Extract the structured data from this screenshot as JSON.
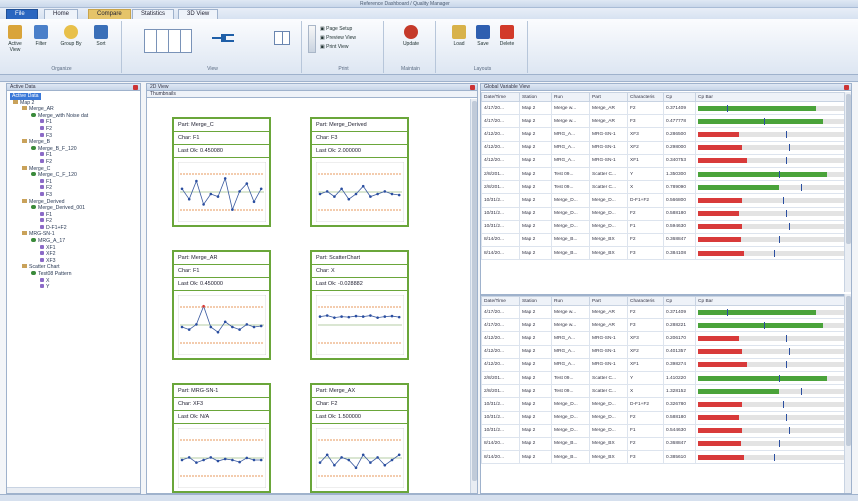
{
  "window": {
    "title": "Reference Dashboard / Quality Manager"
  },
  "tabs": {
    "file": "File",
    "home": "Home",
    "ctx1": "Compare",
    "ctx2": "Statistics",
    "view": "3D View"
  },
  "ribbon": {
    "organize": {
      "label": "Organize",
      "buttons": [
        "Active View",
        "Filter",
        "Group By",
        "Sort"
      ]
    },
    "view": {
      "label": "View"
    },
    "print": {
      "label": "Print",
      "items": [
        "Page Setup",
        "Preview View",
        "Print View"
      ]
    },
    "maintain": {
      "label": "Maintain",
      "button": "Update"
    },
    "layouts": {
      "label": "Layouts",
      "buttons": [
        "Load",
        "Save",
        "Delete"
      ]
    }
  },
  "tree": {
    "header": "Active Data",
    "selected": "Active Data",
    "nodes": [
      {
        "t": "Map 2",
        "d": 0,
        "k": "folder"
      },
      {
        "t": "Merge_AR",
        "d": 1,
        "k": "folder"
      },
      {
        "t": "Merge_with Noise dat",
        "d": 2,
        "k": "node"
      },
      {
        "t": "F1",
        "d": 3,
        "k": "leaf"
      },
      {
        "t": "F2",
        "d": 3,
        "k": "leaf"
      },
      {
        "t": "F3",
        "d": 3,
        "k": "leaf"
      },
      {
        "t": "Merge_B",
        "d": 1,
        "k": "folder"
      },
      {
        "t": "Merge_B_F_120",
        "d": 2,
        "k": "node"
      },
      {
        "t": "F1",
        "d": 3,
        "k": "leaf"
      },
      {
        "t": "F2",
        "d": 3,
        "k": "leaf"
      },
      {
        "t": "Merge_C",
        "d": 1,
        "k": "folder"
      },
      {
        "t": "Merge_C_F_120",
        "d": 2,
        "k": "node"
      },
      {
        "t": "F1",
        "d": 3,
        "k": "leaf"
      },
      {
        "t": "F2",
        "d": 3,
        "k": "leaf"
      },
      {
        "t": "F3",
        "d": 3,
        "k": "leaf"
      },
      {
        "t": "Merge_Derived",
        "d": 1,
        "k": "folder"
      },
      {
        "t": "Merge_Derived_001",
        "d": 2,
        "k": "node"
      },
      {
        "t": "F1",
        "d": 3,
        "k": "leaf"
      },
      {
        "t": "F2",
        "d": 3,
        "k": "leaf"
      },
      {
        "t": "D-F1+F2",
        "d": 3,
        "k": "leaf"
      },
      {
        "t": "MRG-SN-1",
        "d": 1,
        "k": "folder"
      },
      {
        "t": "MRG_A_17",
        "d": 2,
        "k": "node"
      },
      {
        "t": "XF1",
        "d": 3,
        "k": "leaf"
      },
      {
        "t": "XF2",
        "d": 3,
        "k": "leaf"
      },
      {
        "t": "XF3",
        "d": 3,
        "k": "leaf"
      },
      {
        "t": "Scatter Chart",
        "d": 1,
        "k": "folder"
      },
      {
        "t": "Test08 Pattern",
        "d": 2,
        "k": "node"
      },
      {
        "t": "X",
        "d": 3,
        "k": "leaf"
      },
      {
        "t": "Y",
        "d": 3,
        "k": "leaf"
      }
    ]
  },
  "center": {
    "header": "2D View",
    "subheader": "Thumbnails"
  },
  "cards": [
    {
      "part": "Part: Merge_C",
      "char": "Char: F1",
      "lastok": "Last Ok: 0.450080"
    },
    {
      "part": "Part: Merge_Derived",
      "char": "Char: F3",
      "lastok": "Last Ok: 2.000000"
    },
    {
      "part": "Part: Merge_AR",
      "char": "Char: F1",
      "lastok": "Last Ok: 0.450000"
    },
    {
      "part": "Part: ScatterChart",
      "char": "Char: X",
      "lastok": "Last Ok: -0.028882"
    },
    {
      "part": "Part: MRG-SN-1",
      "char": "Char: XF3",
      "lastok": "Last Ok: N/A"
    },
    {
      "part": "Part: Merge_AX",
      "char": "Char: F2",
      "lastok": "Last Ok: 1.500000"
    }
  ],
  "right": {
    "header": "Global Variable View"
  },
  "grid": {
    "columns": [
      "Date/Time",
      "Station",
      "Run",
      "Part",
      "Characteris",
      "Cp",
      "Cp Bar"
    ],
    "rows1": [
      {
        "c": [
          "4/17/20...",
          "Map 2",
          "Merge w...",
          "Merge_AR",
          "F2",
          "0.371409"
        ],
        "v": 0.8,
        "col": "#4aa33a",
        "m": 0.2
      },
      {
        "c": [
          "4/17/20...",
          "Map 2",
          "Merge w...",
          "Merge_AR",
          "F3",
          "0.477778"
        ],
        "v": 0.85,
        "col": "#4aa33a",
        "m": 0.45
      },
      {
        "c": [
          "4/12/20...",
          "Map 2",
          "MRG_A...",
          "MRG-SN-1",
          "XF3",
          "0.286500"
        ],
        "v": 0.28,
        "col": "#d83a3a",
        "m": 0.6
      },
      {
        "c": [
          "4/12/20...",
          "Map 2",
          "MRG_A...",
          "MRG-SN-1",
          "XF2",
          "0.298000"
        ],
        "v": 0.3,
        "col": "#d83a3a",
        "m": 0.62
      },
      {
        "c": [
          "4/12/20...",
          "Map 2",
          "MRG_A...",
          "MRG-SN-1",
          "XF1",
          "0.340753"
        ],
        "v": 0.33,
        "col": "#d83a3a",
        "m": 0.6
      },
      {
        "c": [
          "2/8/201...",
          "Map 2",
          "Test 09...",
          "Scatter C...",
          "Y",
          "1.350300"
        ],
        "v": 0.88,
        "col": "#4aa33a",
        "m": 0.55
      },
      {
        "c": [
          "2/8/201...",
          "Map 2",
          "Test 09...",
          "Scatter C...",
          "X",
          "0.789090"
        ],
        "v": 0.55,
        "col": "#4aa33a",
        "m": 0.7
      },
      {
        "c": [
          "10/31/2...",
          "Map 2",
          "Merge_D...",
          "Merge_D...",
          "D-F1+F2",
          "0.566800"
        ],
        "v": 0.3,
        "col": "#d83a3a",
        "m": 0.58
      },
      {
        "c": [
          "10/31/2...",
          "Map 2",
          "Merge_D...",
          "Merge_D...",
          "F2",
          "0.588180"
        ],
        "v": 0.28,
        "col": "#d83a3a",
        "m": 0.6
      },
      {
        "c": [
          "10/31/2...",
          "Map 2",
          "Merge_D...",
          "Merge_D...",
          "F1",
          "0.594630"
        ],
        "v": 0.3,
        "col": "#d83a3a",
        "m": 0.62
      },
      {
        "c": [
          "8/14/20...",
          "Map 2",
          "Merge_B...",
          "Merge_BX",
          "F2",
          "0.368847"
        ],
        "v": 0.29,
        "col": "#d83a3a",
        "m": 0.55
      },
      {
        "c": [
          "8/14/20...",
          "Map 2",
          "Merge_B...",
          "Merge_BX",
          "F3",
          "0.384108"
        ],
        "v": 0.31,
        "col": "#d83a3a",
        "m": 0.52
      }
    ],
    "rows2": [
      {
        "c": [
          "4/17/20...",
          "Map 2",
          "Merge w...",
          "Merge_AR",
          "F2",
          "0.371409"
        ],
        "v": 0.8,
        "col": "#4aa33a",
        "m": 0.2
      },
      {
        "c": [
          "4/17/20...",
          "Map 2",
          "Merge w...",
          "Merge_AR",
          "F3",
          "0.288221"
        ],
        "v": 0.85,
        "col": "#4aa33a",
        "m": 0.45
      },
      {
        "c": [
          "4/12/20...",
          "Map 2",
          "MRG_A...",
          "MRG-SN-1",
          "XF3",
          "0.206170"
        ],
        "v": 0.28,
        "col": "#d83a3a",
        "m": 0.6
      },
      {
        "c": [
          "4/12/20...",
          "Map 2",
          "MRG_A...",
          "MRG-SN-1",
          "XF2",
          "0.401357"
        ],
        "v": 0.3,
        "col": "#d83a3a",
        "m": 0.62
      },
      {
        "c": [
          "4/12/20...",
          "Map 2",
          "MRG_A...",
          "MRG-SN-1",
          "XF1",
          "0.398274"
        ],
        "v": 0.33,
        "col": "#d83a3a",
        "m": 0.6
      },
      {
        "c": [
          "2/8/201...",
          "Map 2",
          "Test 09...",
          "Scatter C...",
          "Y",
          "1.410220"
        ],
        "v": 0.88,
        "col": "#4aa33a",
        "m": 0.55
      },
      {
        "c": [
          "2/8/201...",
          "Map 2",
          "Test 09...",
          "Scatter C...",
          "X",
          "1.328152"
        ],
        "v": 0.55,
        "col": "#4aa33a",
        "m": 0.7
      },
      {
        "c": [
          "10/31/2...",
          "Map 2",
          "Merge_D...",
          "Merge_D...",
          "D-F1+F2",
          "0.326780"
        ],
        "v": 0.3,
        "col": "#d83a3a",
        "m": 0.58
      },
      {
        "c": [
          "10/31/2...",
          "Map 2",
          "Merge_D...",
          "Merge_D...",
          "F2",
          "0.588180"
        ],
        "v": 0.28,
        "col": "#d83a3a",
        "m": 0.6
      },
      {
        "c": [
          "10/31/2...",
          "Map 2",
          "Merge_D...",
          "Merge_D...",
          "F1",
          "0.544630"
        ],
        "v": 0.3,
        "col": "#d83a3a",
        "m": 0.62
      },
      {
        "c": [
          "8/14/20...",
          "Map 2",
          "Merge_B...",
          "Merge_BX",
          "F2",
          "0.368847"
        ],
        "v": 0.29,
        "col": "#d83a3a",
        "m": 0.55
      },
      {
        "c": [
          "8/14/20...",
          "Map 2",
          "Merge_B...",
          "Merge_BX",
          "F3",
          "0.385610"
        ],
        "v": 0.31,
        "col": "#d83a3a",
        "m": 0.52
      }
    ]
  },
  "colors": {
    "green": "#4aa33a",
    "red": "#d83a3a",
    "card_border": "#6aa63a"
  }
}
